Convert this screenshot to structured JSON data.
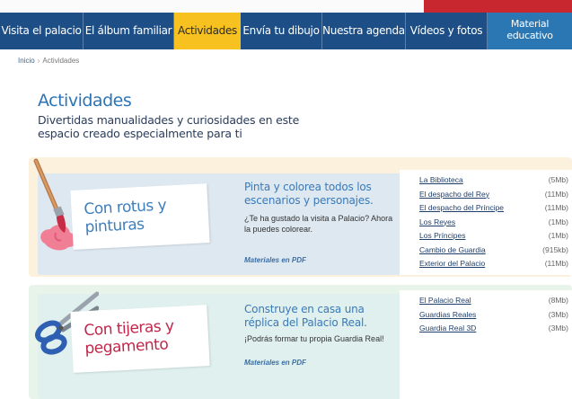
{
  "top": {
    "logo_fragment": "·····",
    "deco_fragment": "~ ~ ~ ~",
    "corner_fragment": ""
  },
  "nav": {
    "items": [
      {
        "label": "Visita el palacio"
      },
      {
        "label": "El álbum familiar"
      },
      {
        "label": "Actividades"
      },
      {
        "label": "Envía tu dibujo"
      },
      {
        "label": "Nuestra agenda"
      },
      {
        "label": "Vídeos y fotos"
      }
    ],
    "material_line1": "Material",
    "material_line2": "educativo",
    "active_color": "#f7c21f",
    "bar_color": "#1d4f86"
  },
  "breadcrumb": {
    "home": "Inicio",
    "separator": "›",
    "current": "Actividades"
  },
  "page": {
    "title": "Actividades",
    "intro": "Divertidas manualidades y curiosidades en este espacio creado especialmente para ti"
  },
  "sections": [
    {
      "card_title": "Con rotus y\npinturas",
      "heading": "Pinta y colorea todos los escenarios y personajes.",
      "description": "¿Te ha gustado la visita a Palacio? Ahora la puedes colorear.",
      "pdf_link": "Materiales en PDF",
      "icon": "paintbrush-icon",
      "items": [
        {
          "name": "La Biblioteca",
          "size": "(5Mb)"
        },
        {
          "name": "El despacho del Rey",
          "size": "(11Mb)"
        },
        {
          "name": "El despacho del Príncipe",
          "size": "(11Mb)"
        },
        {
          "name": "Los Reyes",
          "size": "(1Mb)"
        },
        {
          "name": "Los Príncipes",
          "size": "(1Mb)"
        },
        {
          "name": "Cambio de Guardia",
          "size": "(915kb)"
        },
        {
          "name": "Exterior del Palacio",
          "size": "(11Mb)"
        }
      ]
    },
    {
      "card_title": "Con tijeras y\npegamento",
      "heading": "Construye en casa una réplica del Palacio Real.",
      "description": "¡Podrás formar tu propia Guardia Real!",
      "pdf_link": "Materiales en PDF",
      "icon": "scissors-icon",
      "items": [
        {
          "name": "El Palacio Real",
          "size": "(8Mb)"
        },
        {
          "name": "Guardias Reales",
          "size": "(3Mb)"
        },
        {
          "name": "Guardia Real 3D",
          "size": "(3Mb)"
        }
      ]
    }
  ]
}
